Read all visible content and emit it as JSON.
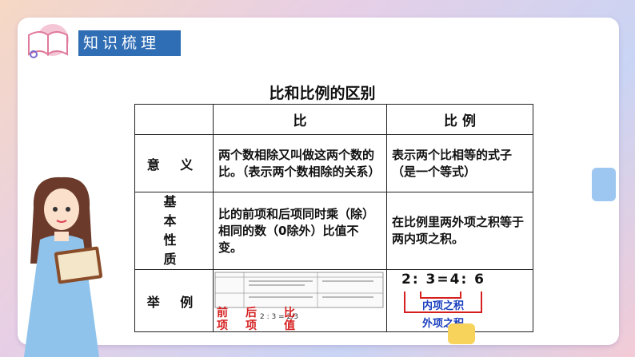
{
  "header": {
    "title": "知识梳理"
  },
  "table": {
    "title": "比和比例的区别",
    "col_headers": [
      "比",
      "比 例"
    ],
    "rows": [
      {
        "label": "意 义",
        "ratio": "两个数相除又叫做这两个数的比。（表示两个数相除的关系）",
        "proportion": "表示两个比相等的式子（是一个等式）"
      },
      {
        "label": "基 本 性 质",
        "ratio": "比的前项和后项同时乘（除）相同的数（0除外）比值不变。",
        "proportion": "在比例里两外项之积等于两内项之积。"
      },
      {
        "label": "举 例"
      }
    ]
  },
  "example": {
    "mini_labels": [
      "前项",
      "后项",
      "比值"
    ],
    "mini_expr": "2 : 3 = 2/3",
    "proportion_expr": "2: 3=4: 6",
    "inner_label": "内项之积",
    "outer_label": "外项之积"
  },
  "colors": {
    "accent": "#2f6db5",
    "red": "#d62020",
    "blue": "#1a3fbf"
  }
}
